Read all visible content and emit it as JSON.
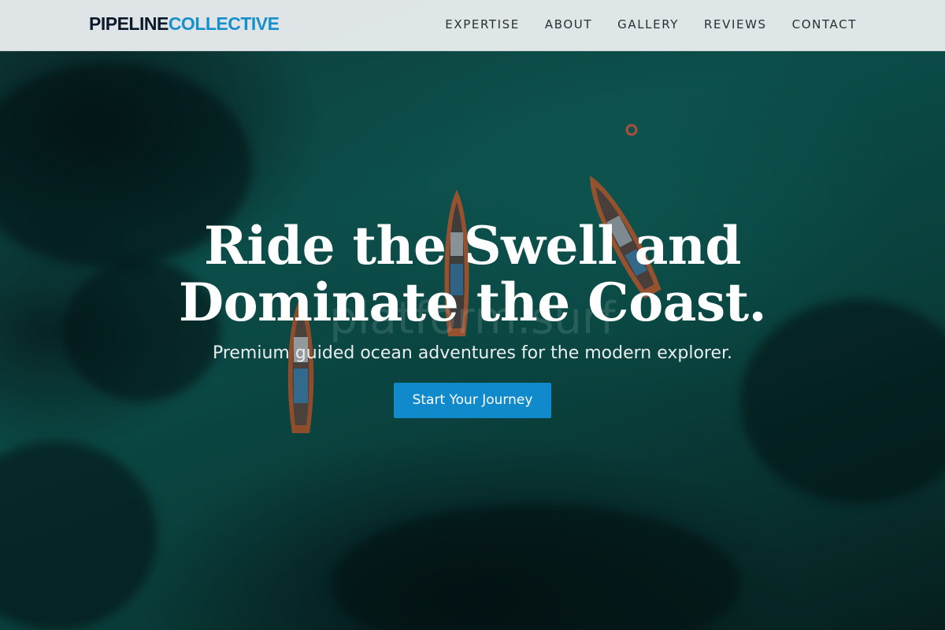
{
  "brand": {
    "name_dark": "PIPELINE",
    "name_accent": "COLLECTIVE"
  },
  "nav": {
    "items": [
      {
        "label": "EXPERTISE"
      },
      {
        "label": "ABOUT"
      },
      {
        "label": "GALLERY"
      },
      {
        "label": "REVIEWS"
      },
      {
        "label": "CONTACT"
      }
    ]
  },
  "hero": {
    "title": "Ride the Swell and Dominate the Coast.",
    "subtitle": "Premium guided ocean adventures for the modern explorer.",
    "cta_label": "Start Your Journey",
    "watermark": "platform.surf"
  },
  "colors": {
    "brand_dark": "#0b1a2b",
    "accent": "#1690cc",
    "cta_background": "#118acb",
    "navbar_background": "#e8eced",
    "ocean": "#0f5f5a"
  }
}
